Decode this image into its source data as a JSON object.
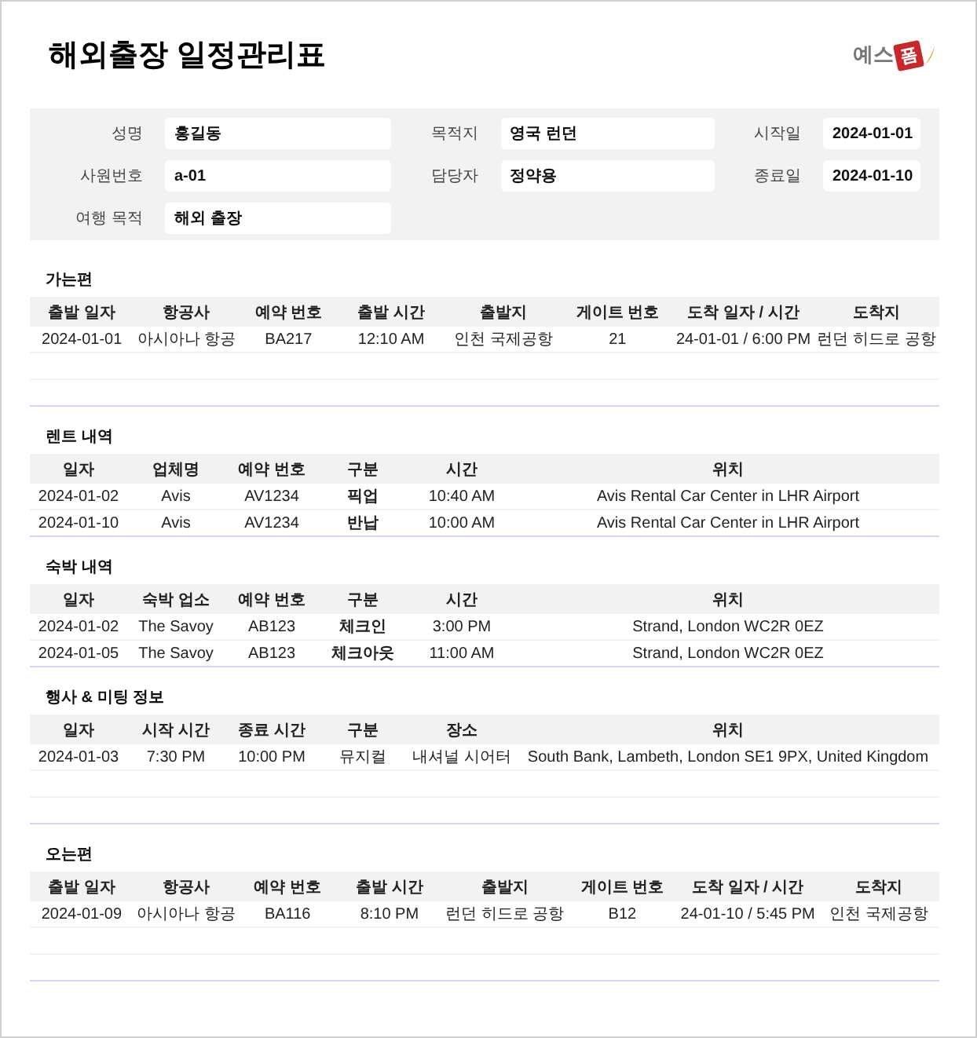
{
  "title": "해외출장 일정관리표",
  "logo": {
    "text": "예스",
    "badge": "폼"
  },
  "info": [
    {
      "label": "성명",
      "value": "홍길동"
    },
    {
      "label": "목적지",
      "value": "영국 런던"
    },
    {
      "label": "시작일",
      "value": "2024-01-01"
    },
    {
      "label": "사원번호",
      "value": "a-01"
    },
    {
      "label": "담당자",
      "value": "정약용"
    },
    {
      "label": "종료일",
      "value": "2024-01-10"
    },
    {
      "label": "여행 목적",
      "value": "해외 출장"
    }
  ],
  "sections": [
    {
      "title": "가는편",
      "kind": "flight",
      "padded": true,
      "columns": [
        "출발 일자",
        "항공사",
        "예약 번호",
        "출발 시간",
        "출발지",
        "게이트 번호",
        "도착 일자 / 시간",
        "도착지"
      ],
      "rows": [
        [
          "2024-01-01",
          "아시아나 항공",
          "BA217",
          "12:10 AM",
          "인천 국제공항",
          "21",
          "24-01-01 / 6:00 PM",
          "런던 히드로 공항"
        ]
      ]
    },
    {
      "title": "렌트 내역",
      "kind": "booking",
      "padded": false,
      "columns": [
        "일자",
        "업체명",
        "예약 번호",
        "구분",
        "시간",
        "위치"
      ],
      "rows": [
        [
          "2024-01-02",
          "Avis",
          "AV1234",
          "픽업",
          "10:40 AM",
          "Avis Rental Car Center in LHR Airport"
        ],
        [
          "2024-01-10",
          "Avis",
          "AV1234",
          "반납",
          "10:00 AM",
          "Avis Rental Car Center in LHR Airport"
        ]
      ]
    },
    {
      "title": "숙박 내역",
      "kind": "booking",
      "padded": false,
      "columns": [
        "일자",
        "숙박 업소",
        "예약 번호",
        "구분",
        "시간",
        "위치"
      ],
      "rows": [
        [
          "2024-01-02",
          "The Savoy",
          "AB123",
          "체크인",
          "3:00 PM",
          "Strand, London WC2R 0EZ"
        ],
        [
          "2024-01-05",
          "The Savoy",
          "AB123",
          "체크아웃",
          "11:00 AM",
          "Strand, London WC2R 0EZ"
        ]
      ]
    },
    {
      "title": "행사 & 미팅 정보",
      "kind": "event",
      "padded": true,
      "columns": [
        "일자",
        "시작 시간",
        "종료 시간",
        "구분",
        "장소",
        "위치"
      ],
      "rows": [
        [
          "2024-01-03",
          "7:30 PM",
          "10:00 PM",
          "뮤지컬",
          "내셔널 시어터",
          "South Bank, Lambeth, London SE1 9PX, United Kingdom"
        ]
      ]
    },
    {
      "title": "오는편",
      "kind": "flight",
      "padded": true,
      "columns": [
        "출발 일자",
        "항공사",
        "예약 번호",
        "출발 시간",
        "출발지",
        "게이트 번호",
        "도착 일자 / 시간",
        "도착지"
      ],
      "rows": [
        [
          "2024-01-09",
          "아시아나 항공",
          "BA116",
          "8:10 PM",
          "런던 히드로 공항",
          "B12",
          "24-01-10 / 5:45 PM",
          "인천 국제공항"
        ]
      ]
    }
  ]
}
